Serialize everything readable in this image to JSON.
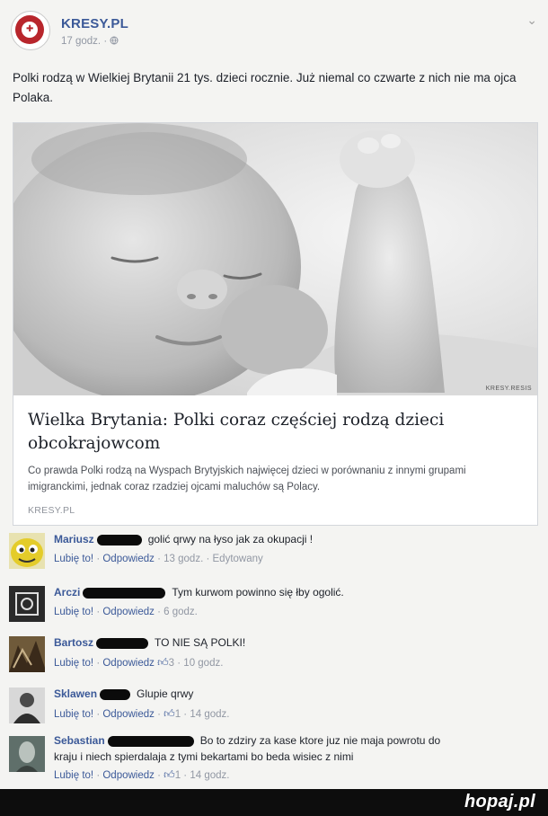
{
  "post": {
    "page_name": "KRESY.PL",
    "time": "17 godz.",
    "audience_icon": "globe-icon",
    "text": "Polki rodzą w Wielkiej Brytanii 21 tys. dzieci rocznie. Już niemal co czwarte z nich nie ma ojca Polaka."
  },
  "link_card": {
    "image_watermark": "KRESY.RESIS",
    "title": "Wielka Brytania: Polki coraz częściej rodzą dzieci obcokrajowcom",
    "description": "Co prawda Polki rodzą na Wyspach Brytyjskich najwięcej dzieci w porównaniu z innymi grupami imigranckimi, jednak coraz rzadziej ojcami maluchów są Polacy.",
    "domain": "KRESY.PL"
  },
  "comments": [
    {
      "name": "Mariusz",
      "text": "golić qrwy na łyso jak za okupacji !",
      "like": "Lubię to!",
      "reply": "Odpowiedz",
      "likes": "",
      "time": "13 godz.",
      "extra": "Edytowany"
    },
    {
      "name": "Arczi",
      "text": "Tym kurwom powinno się łby ogolić.",
      "like": "Lubię to!",
      "reply": "Odpowiedz",
      "likes": "",
      "time": "6 godz.",
      "extra": ""
    },
    {
      "name": "Bartosz",
      "text": "TO NIE SĄ POLKI!",
      "like": "Lubię to!",
      "reply": "Odpowiedz",
      "likes": "3",
      "time": "10 godz.",
      "extra": ""
    },
    {
      "name": "Sklawen",
      "text": "Glupie qrwy",
      "like": "Lubię to!",
      "reply": "Odpowiedz",
      "likes": "1",
      "time": "14 godz.",
      "extra": ""
    },
    {
      "name": "Sebastian",
      "text": "Bo to zdziry za kase ktore juz nie maja powrotu do",
      "text2": "kraju i niech spierdalaja z tymi bekartami bo beda wisiec z nimi",
      "like": "Lubię to!",
      "reply": "Odpowiedz",
      "likes": "1",
      "time": "14 godz.",
      "extra": ""
    }
  ],
  "footer": {
    "brand": "hopaj.pl"
  },
  "colors": {
    "link_blue": "#3b5998",
    "meta_gray": "#9197a3",
    "logo_red": "#b8262c"
  }
}
